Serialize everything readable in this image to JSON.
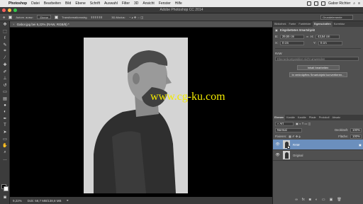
{
  "menubar": {
    "app": "Photoshop",
    "items": [
      "Datei",
      "Bearbeiten",
      "Bild",
      "Ebene",
      "Schrift",
      "Auswahl",
      "Filter",
      "3D",
      "Ansicht",
      "Fenster",
      "Hilfe"
    ],
    "user": "Gabor Richter"
  },
  "titlebar": {
    "title": "Adobe Photoshop CC 2014"
  },
  "options": {
    "autoselect": "Autom. ausw.:",
    "target": "Ebene",
    "transform": "Transformationsstrg.",
    "mode3d": "3D-Modus:",
    "workspace": "Grundelemente"
  },
  "document": {
    "tab_title": "Gabor.jpg bei 9,22% (RAW, RGB/8) *",
    "zoom": "9,22%",
    "docsize": "Dok: 58,7 MB/138,8 MB",
    "watermark": "www.cg-ku.com"
  },
  "properties": {
    "tabs": [
      "Bibliothek",
      "Farbe",
      "Farbfelder",
      "Eigenschaften",
      "Korrektur"
    ],
    "active_tab": "Eigenschaften",
    "header": "Eingebettetes Smartobjekt",
    "w_label": "B:",
    "w_value": "29,55 cm",
    "h_label": "H:",
    "h_value": "43,54 cm",
    "x_label": "X:",
    "x_value": "0 cm",
    "y_label": "Y:",
    "y_value": "0 cm",
    "comps_label": "RAW",
    "comps_value": "Ebenenkomposition nicht anwenden",
    "btn_edit": "Inhalt bearbeiten",
    "btn_convert": "In verknüpftes Smartobjekt konvertieren..."
  },
  "layers": {
    "tabs": [
      "Ebenen",
      "Kanäle",
      "Kanäle",
      "Pfade",
      "Protokoll",
      "Absatz"
    ],
    "filter_kind": "Art",
    "blend_mode": "Normal",
    "opacity_label": "Deckkraft:",
    "opacity_value": "100%",
    "lock_label": "Fixieren:",
    "fill_label": "Fläche:",
    "fill_value": "100%",
    "items": [
      {
        "name": "RAW",
        "selected": true
      },
      {
        "name": "Original",
        "selected": false
      }
    ]
  },
  "colors": {
    "accent": "#6b8fbd",
    "watermark": "#f2ea00"
  }
}
